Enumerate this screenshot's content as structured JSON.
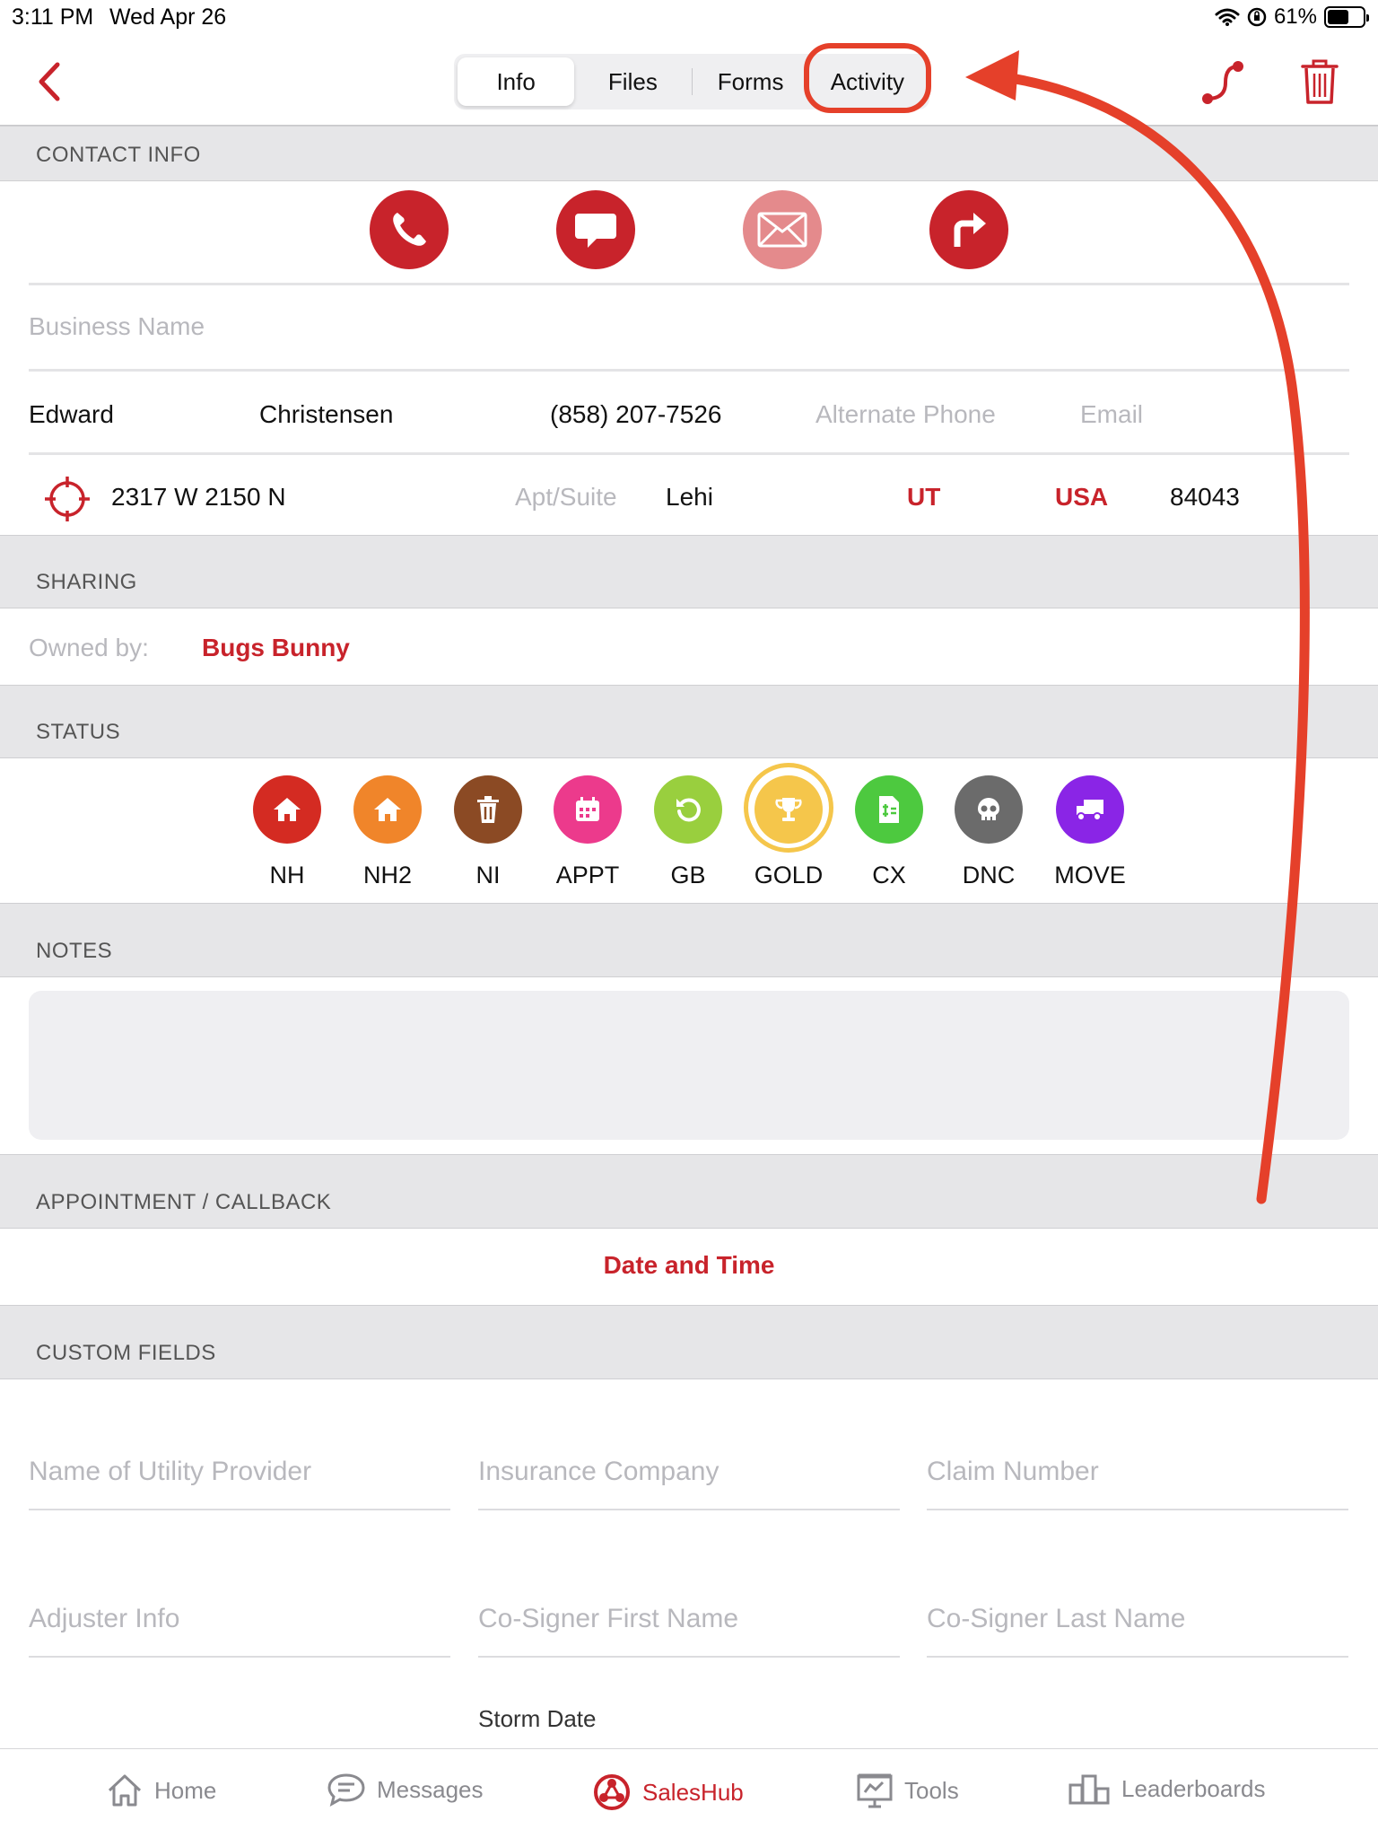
{
  "status_bar": {
    "time": "3:11 PM",
    "date": "Wed Apr 26",
    "battery": "61%"
  },
  "nav": {
    "tabs": [
      {
        "label": "Info"
      },
      {
        "label": "Files"
      },
      {
        "label": "Forms"
      },
      {
        "label": "Activity"
      }
    ],
    "active_tab": "Info",
    "highlighted_tab": "Activity"
  },
  "contact": {
    "header": "CONTACT INFO",
    "business_placeholder": "Business Name",
    "first_name": "Edward",
    "last_name": "Christensen",
    "phone": "(858) 207-7526",
    "alt_phone_placeholder": "Alternate Phone",
    "email_placeholder": "Email",
    "street": "2317 W 2150 N",
    "apt_placeholder": "Apt/Suite",
    "city": "Lehi",
    "state": "UT",
    "country": "USA",
    "zip": "84043"
  },
  "sharing": {
    "header": "SHARING",
    "owned_label": "Owned by:",
    "owner": "Bugs Bunny"
  },
  "status": {
    "header": "STATUS",
    "items": [
      {
        "label": "NH",
        "color": "#d42b22",
        "icon": "home-icon"
      },
      {
        "label": "NH2",
        "color": "#f0852a",
        "icon": "home-icon"
      },
      {
        "label": "NI",
        "color": "#8b4a24",
        "icon": "trash-icon"
      },
      {
        "label": "APPT",
        "color": "#ec3a8c",
        "icon": "calendar-icon"
      },
      {
        "label": "GB",
        "color": "#99cf3e",
        "icon": "refresh-icon"
      },
      {
        "label": "GOLD",
        "color": "#f5c64b",
        "icon": "trophy-icon"
      },
      {
        "label": "CX",
        "color": "#4dc93f",
        "icon": "document-icon"
      },
      {
        "label": "DNC",
        "color": "#6b6b6b",
        "icon": "skull-icon"
      },
      {
        "label": "MOVE",
        "color": "#8a25e6",
        "icon": "truck-icon"
      }
    ],
    "selected": "GOLD"
  },
  "notes": {
    "header": "NOTES"
  },
  "appointment": {
    "header": "APPOINTMENT / CALLBACK",
    "date_time": "Date and Time"
  },
  "custom_fields": {
    "header": "CUSTOM FIELDS",
    "placeholders": [
      "Name of Utility Provider",
      "Insurance Company",
      "Claim Number",
      "Adjuster Info",
      "Co-Signer First Name",
      "Co-Signer Last Name"
    ],
    "storm_date_label": "Storm Date"
  },
  "tabbar": {
    "items": [
      {
        "label": "Home",
        "icon": "home-icon"
      },
      {
        "label": "Messages",
        "icon": "messages-icon"
      },
      {
        "label": "SalesHub",
        "icon": "saleshub-icon"
      },
      {
        "label": "Tools",
        "icon": "tools-icon"
      },
      {
        "label": "Leaderboards",
        "icon": "leaderboards-icon"
      }
    ],
    "active": "SalesHub"
  },
  "colors": {
    "brand_red": "#c8232b",
    "annotation_red": "#e5402a",
    "section_bg": "#e6e6e8"
  }
}
